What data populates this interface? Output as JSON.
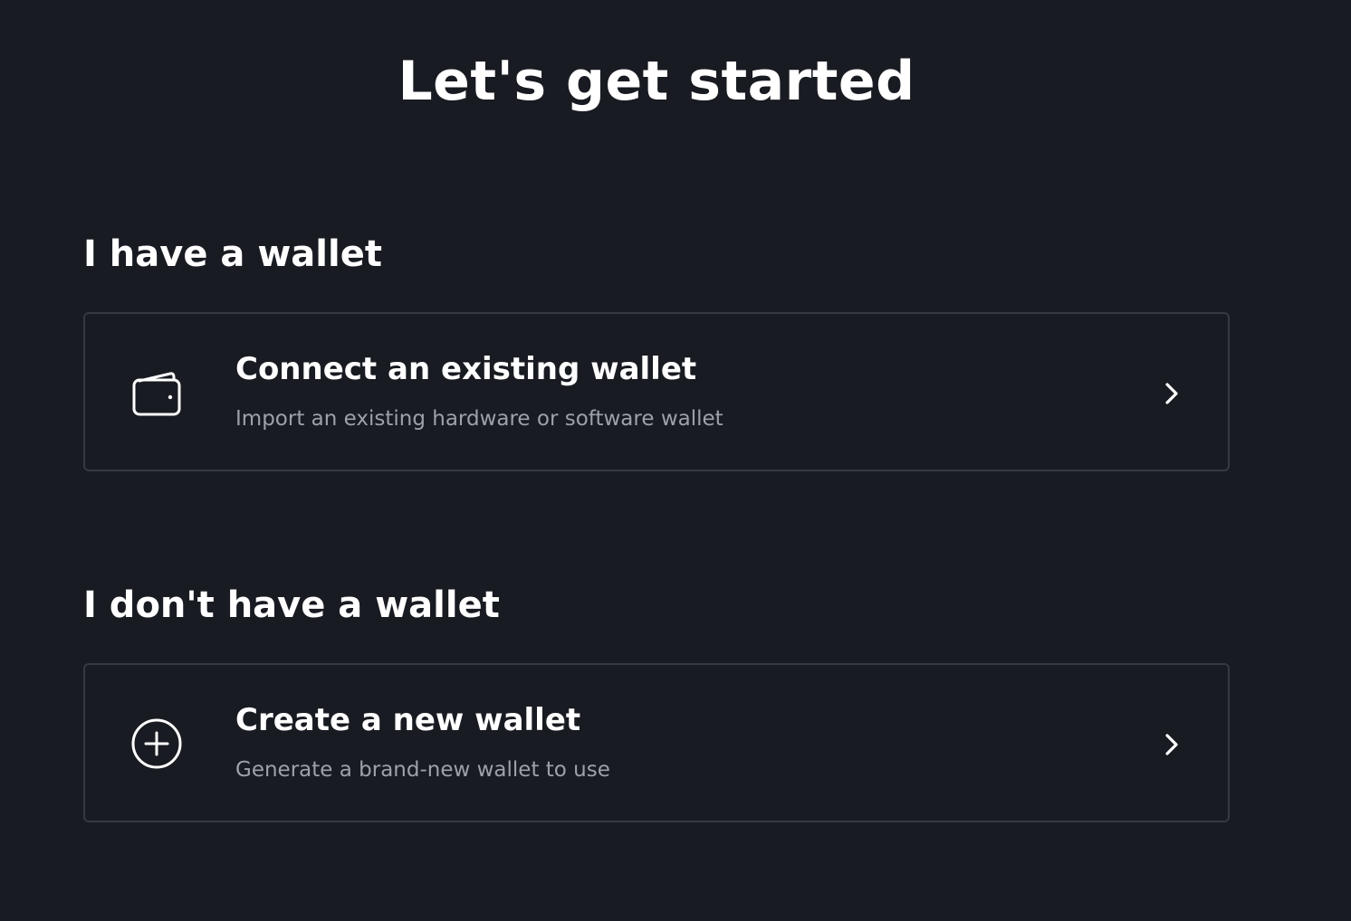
{
  "page": {
    "title": "Let's get started"
  },
  "sections": [
    {
      "heading": "I have a wallet",
      "option": {
        "title": "Connect an existing wallet",
        "description": "Import an existing hardware or software wallet",
        "icon": "wallet-icon",
        "action_icon": "chevron-right-icon"
      }
    },
    {
      "heading": "I don't have a wallet",
      "option": {
        "title": "Create a new wallet",
        "description": "Generate a brand-new wallet to use",
        "icon": "plus-circle-icon",
        "action_icon": "chevron-right-icon"
      }
    }
  ],
  "colors": {
    "background": "#191b22",
    "card_border": "#363940",
    "text_primary": "#ffffff",
    "text_secondary": "#9da1a9"
  }
}
